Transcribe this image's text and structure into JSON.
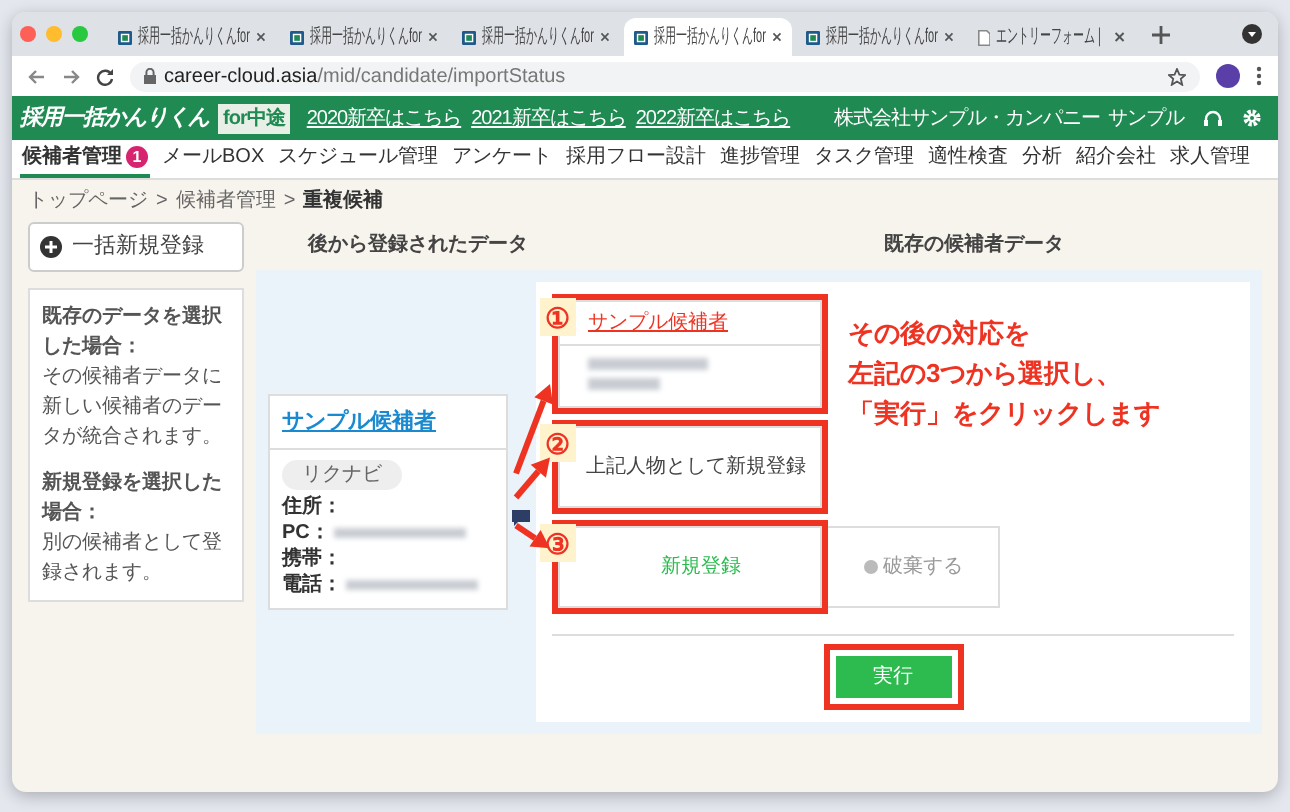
{
  "browser": {
    "tabs": [
      {
        "kind": "site",
        "title": "採用一括かんりくんfor",
        "selected": false
      },
      {
        "kind": "site",
        "title": "採用一括かんりくんfor",
        "selected": false
      },
      {
        "kind": "site",
        "title": "採用一括かんりくんfor",
        "selected": false
      },
      {
        "kind": "site",
        "title": "採用一括かんりくんfor",
        "selected": true
      },
      {
        "kind": "site",
        "title": "採用一括かんりくんfor",
        "selected": false
      },
      {
        "kind": "document",
        "title": "エントリーフォーム |",
        "selected": false
      }
    ],
    "url": {
      "host": "career-cloud.asia",
      "path": "/mid/candidate/importStatus"
    }
  },
  "header": {
    "logo": "採用一括かんりくん",
    "logo_badge": "for中途",
    "links": [
      "2020新卒はこちら",
      "2021新卒はこちら",
      "2022新卒はこちら"
    ],
    "company": "株式会社サンプル・カンパニー",
    "user": "サンプル"
  },
  "nav": [
    {
      "label": "候補者管理",
      "selected": true,
      "badge": "1"
    },
    {
      "label": "メールBOX",
      "selected": false
    },
    {
      "label": "スケジュール管理",
      "selected": false
    },
    {
      "label": "アンケート",
      "selected": false
    },
    {
      "label": "採用フロー設計",
      "selected": false
    },
    {
      "label": "進捗管理",
      "selected": false
    },
    {
      "label": "タスク管理",
      "selected": false
    },
    {
      "label": "適性検査",
      "selected": false
    },
    {
      "label": "分析",
      "selected": false
    },
    {
      "label": "紹介会社",
      "selected": false
    },
    {
      "label": "求人管理",
      "selected": false
    }
  ],
  "breadcrumb": {
    "items": [
      "トップページ",
      "候補者管理",
      "重複候補"
    ],
    "separator": ">"
  },
  "bulk_button": "一括新規登録",
  "help": [
    {
      "heading": "既存のデータを選択した場合：",
      "body": "その候補者データに新しい候補者のデータが統合されます。"
    },
    {
      "heading": "新規登録を選択した場合：",
      "body": "別の候補者として登録されます。"
    }
  ],
  "incoming": {
    "heading": "後から登録されたデータ",
    "name": "サンプル候補者",
    "source": "リクナビ",
    "fields": [
      {
        "label": "住所：",
        "blurred": false
      },
      {
        "label": "PC：",
        "blurred": true
      },
      {
        "label": "携帯：",
        "blurred": false
      },
      {
        "label": "電話：",
        "blurred": true
      }
    ]
  },
  "existing": {
    "heading": "既存の候補者データ",
    "options": [
      {
        "kind": "candidate",
        "marker": "①",
        "label": "サンプル候補者"
      },
      {
        "kind": "merge_new",
        "marker": "②",
        "label": "上記人物として新規登録"
      },
      {
        "kind": "new",
        "marker": "③",
        "label": "新規登録"
      }
    ],
    "discard": {
      "label": "破棄する",
      "disabled": true
    },
    "execute": "実行"
  },
  "annotation": [
    "その後の対応を",
    "左記の3つから選択し、",
    "「実行」をクリックします"
  ]
}
